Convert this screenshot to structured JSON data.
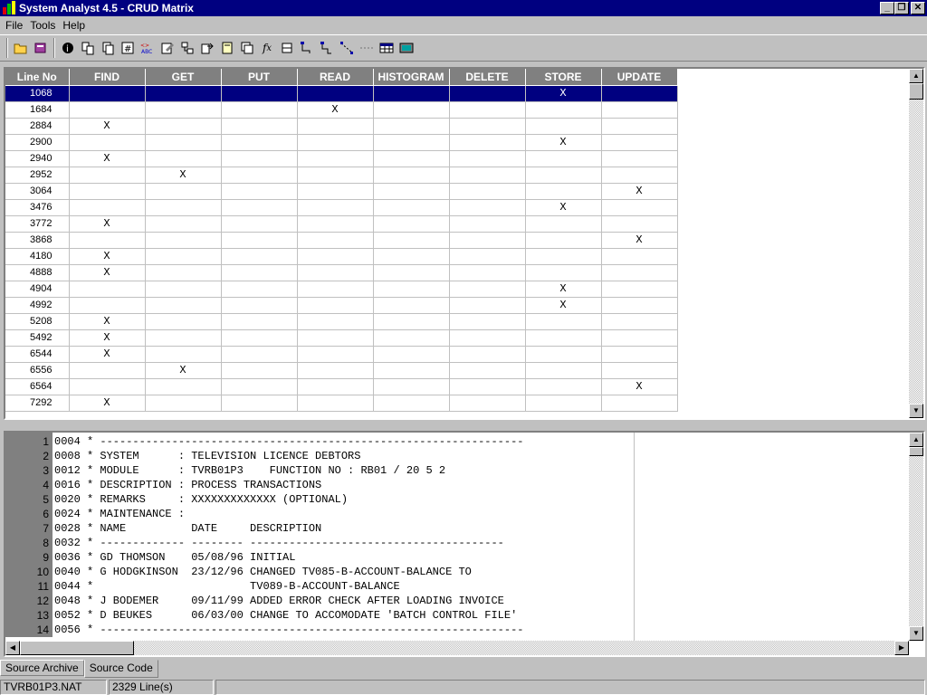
{
  "window": {
    "title": "System Analyst 4.5 - CRUD Matrix"
  },
  "menu": [
    {
      "label": "File"
    },
    {
      "label": "Tools"
    },
    {
      "label": "Help"
    }
  ],
  "toolbar": {
    "icons": [
      "open-folder-icon",
      "book-icon",
      "info-icon",
      "cut-copy-icon",
      "copy-icon",
      "hash-icon",
      "abc-rename-icon",
      "edit-icon",
      "diagram-icon",
      "export-icon",
      "page-icon",
      "multipage-icon",
      "function-icon",
      "print-icon",
      "flow-icon",
      "flow2-icon",
      "path-icon",
      "dots-icon",
      "table-icon",
      "screen-icon"
    ]
  },
  "matrix": {
    "columns": [
      "Line No",
      "FIND",
      "GET",
      "PUT",
      "READ",
      "HISTOGRAM",
      "DELETE",
      "STORE",
      "UPDATE"
    ],
    "rows": [
      {
        "line": "1068",
        "cells": [
          "",
          "",
          "",
          "",
          "",
          "",
          "X",
          ""
        ]
      },
      {
        "line": "1684",
        "cells": [
          "",
          "",
          "",
          "X",
          "",
          "",
          "",
          ""
        ]
      },
      {
        "line": "2884",
        "cells": [
          "X",
          "",
          "",
          "",
          "",
          "",
          "",
          ""
        ]
      },
      {
        "line": "2900",
        "cells": [
          "",
          "",
          "",
          "",
          "",
          "",
          "X",
          ""
        ]
      },
      {
        "line": "2940",
        "cells": [
          "X",
          "",
          "",
          "",
          "",
          "",
          "",
          ""
        ]
      },
      {
        "line": "2952",
        "cells": [
          "",
          "X",
          "",
          "",
          "",
          "",
          "",
          ""
        ]
      },
      {
        "line": "3064",
        "cells": [
          "",
          "",
          "",
          "",
          "",
          "",
          "",
          "X"
        ]
      },
      {
        "line": "3476",
        "cells": [
          "",
          "",
          "",
          "",
          "",
          "",
          "X",
          ""
        ]
      },
      {
        "line": "3772",
        "cells": [
          "X",
          "",
          "",
          "",
          "",
          "",
          "",
          ""
        ]
      },
      {
        "line": "3868",
        "cells": [
          "",
          "",
          "",
          "",
          "",
          "",
          "",
          "X"
        ]
      },
      {
        "line": "4180",
        "cells": [
          "X",
          "",
          "",
          "",
          "",
          "",
          "",
          ""
        ]
      },
      {
        "line": "4888",
        "cells": [
          "X",
          "",
          "",
          "",
          "",
          "",
          "",
          ""
        ]
      },
      {
        "line": "4904",
        "cells": [
          "",
          "",
          "",
          "",
          "",
          "",
          "X",
          ""
        ]
      },
      {
        "line": "4992",
        "cells": [
          "",
          "",
          "",
          "",
          "",
          "",
          "X",
          ""
        ]
      },
      {
        "line": "5208",
        "cells": [
          "X",
          "",
          "",
          "",
          "",
          "",
          "",
          ""
        ]
      },
      {
        "line": "5492",
        "cells": [
          "X",
          "",
          "",
          "",
          "",
          "",
          "",
          ""
        ]
      },
      {
        "line": "6544",
        "cells": [
          "X",
          "",
          "",
          "",
          "",
          "",
          "",
          ""
        ]
      },
      {
        "line": "6556",
        "cells": [
          "",
          "X",
          "",
          "",
          "",
          "",
          "",
          ""
        ]
      },
      {
        "line": "6564",
        "cells": [
          "",
          "",
          "",
          "",
          "",
          "",
          "",
          "X"
        ]
      },
      {
        "line": "7292",
        "cells": [
          "X",
          "",
          "",
          "",
          "",
          "",
          "",
          ""
        ]
      }
    ],
    "selected_row": 0
  },
  "source": {
    "lines": [
      {
        "n": "1",
        "t": "0004 * -----------------------------------------------------------------"
      },
      {
        "n": "2",
        "t": "0008 * SYSTEM      : TELEVISION LICENCE DEBTORS"
      },
      {
        "n": "3",
        "t": "0012 * MODULE      : TVRB01P3    FUNCTION NO : RB01 / 20 5 2"
      },
      {
        "n": "4",
        "t": "0016 * DESCRIPTION : PROCESS TRANSACTIONS"
      },
      {
        "n": "5",
        "t": "0020 * REMARKS     : XXXXXXXXXXXXX (OPTIONAL)"
      },
      {
        "n": "6",
        "t": "0024 * MAINTENANCE :"
      },
      {
        "n": "7",
        "t": "0028 * NAME          DATE     DESCRIPTION"
      },
      {
        "n": "8",
        "t": "0032 * ------------- -------- ---------------------------------------"
      },
      {
        "n": "9",
        "t": "0036 * GD THOMSON    05/08/96 INITIAL"
      },
      {
        "n": "10",
        "t": "0040 * G HODGKINSON  23/12/96 CHANGED TV085-B-ACCOUNT-BALANCE TO"
      },
      {
        "n": "11",
        "t": "0044 *                        TV089-B-ACCOUNT-BALANCE"
      },
      {
        "n": "12",
        "t": "0048 * J BODEMER     09/11/99 ADDED ERROR CHECK AFTER LOADING INVOICE"
      },
      {
        "n": "13",
        "t": "0052 * D BEUKES      06/03/00 CHANGE TO ACCOMODATE 'BATCH CONTROL FILE'"
      },
      {
        "n": "14",
        "t": "0056 * -----------------------------------------------------------------"
      }
    ]
  },
  "tabs": [
    {
      "label": "Source Archive"
    },
    {
      "label": "Source Code"
    }
  ],
  "status": {
    "file": "TVRB01P3.NAT",
    "lines": "2329 Line(s)"
  }
}
